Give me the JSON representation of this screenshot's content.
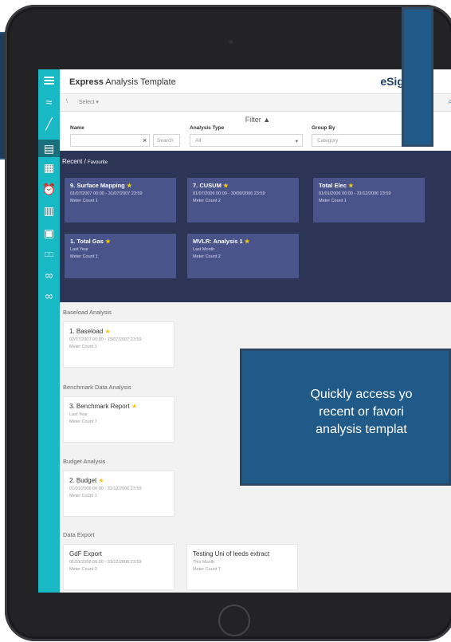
{
  "app": {
    "title_bold": "Express",
    "title_rest": " Analysis Template",
    "brand": "eSight",
    "brand_mark": "®"
  },
  "sidebar": {
    "icons": [
      "menu-icon",
      "analysis-icon",
      "trend-icon",
      "report-icon",
      "dashboard-icon",
      "alarm-icon",
      "building-icon",
      "meter-icon",
      "counter-icon",
      "link-icon",
      "link-icon"
    ]
  },
  "selectbar": {
    "slash": "\\",
    "select_label": "Select ▾"
  },
  "filter": {
    "title": "Filter",
    "name_label": "Name",
    "name_value": "",
    "clear_icon": "×",
    "search_label": "Search",
    "type_label": "Analysis Type",
    "type_value": "All",
    "group_label": "Group By",
    "group_value": "Category"
  },
  "recent": {
    "title": "Recent / ",
    "subtitle": "Favourite",
    "cards": [
      {
        "title": "9. Surface Mapping",
        "line1": "01/07/2007 00:00 - 31/07/2007 23:59",
        "line2": "Meter Count 1"
      },
      {
        "title": "7. CUSUM",
        "line1": "01/07/2006 00:00 - 30/09/2006 23:59",
        "line2": "Meter Count 2"
      },
      {
        "title": "Total Elec",
        "line1": "01/01/2006 00:00 - 31/12/2006 23:59",
        "line2": "Meter Count 1"
      },
      {
        "title": "1. Total Gas",
        "line1": "Last Year",
        "line2": "Meter Count 1"
      },
      {
        "title": "MVLR: Analysis 1",
        "line1": "Last Month",
        "line2": "Meter Count 2"
      }
    ]
  },
  "categories": [
    {
      "name": "Baseload Analysis",
      "cards": [
        {
          "title": "1. Baseload",
          "star": true,
          "line1": "02/07/2007 00:00 - 15/07/2007 23:59",
          "line2": "Meter Count 1"
        }
      ]
    },
    {
      "name": "Benchmark Data Analysis",
      "cards": [
        {
          "title": "3. Benchmark Report",
          "star": true,
          "line1": "Last Year",
          "line2": "Meter Count 7"
        }
      ]
    },
    {
      "name": "Budget Analysis",
      "cards": [
        {
          "title": "2. Budget",
          "star": true,
          "line1": "01/01/2006 00:00 - 31/12/2006 23:59",
          "line2": "Meter Count 1"
        }
      ]
    },
    {
      "name": "Data Export",
      "cards": [
        {
          "title": "GdF Export",
          "star": false,
          "line1": "01/01/2008 00:00 - 31/12/2008 23:59",
          "line2": "Meter Count 3"
        },
        {
          "title": "Testing Uni of leeds extract",
          "star": false,
          "line1": "This Month",
          "line2": "Meter Count 7"
        }
      ]
    }
  ],
  "tooltip": {
    "line1": "Quickly access yo",
    "line2": "recent or favori",
    "line3": "analysis templat"
  },
  "colors": {
    "sidebar": "#18b8c4",
    "panel": "#2d3556",
    "card": "#48548a",
    "star": "#f5c518",
    "tooltip": "#1f5a88"
  }
}
